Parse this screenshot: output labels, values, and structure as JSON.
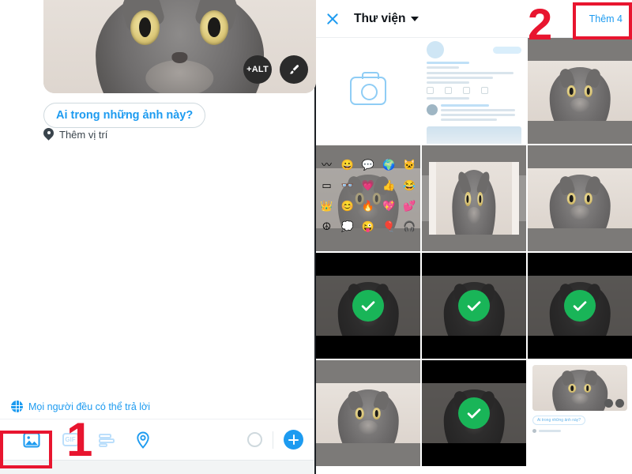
{
  "compose": {
    "photo": {
      "alt_badge": "+ALT",
      "edit_icon": "brush-icon"
    },
    "tag_people_pill": "Ai trong những ảnh này?",
    "add_location": "Thêm vị trí",
    "reply_scope": "Mọi người đều có thể trả lời",
    "toolbar": {
      "image": "image-icon",
      "gif": "GIF",
      "poll": "poll-icon",
      "location": "location-icon",
      "progress": "progress-circle",
      "add": "plus-icon"
    }
  },
  "gallery": {
    "close": "close-icon",
    "title": "Thư viện",
    "dropdown": "chevron-down-icon",
    "add_button": "Thêm 4",
    "cells": [
      {
        "kind": "camera",
        "selected": false
      },
      {
        "kind": "feed-screenshot",
        "selected": false
      },
      {
        "kind": "cat-photo",
        "selected": false
      },
      {
        "kind": "cat-stickers",
        "selected": false
      },
      {
        "kind": "cat-framed",
        "selected": false
      },
      {
        "kind": "cat-photo",
        "selected": false
      },
      {
        "kind": "cat-photo-dark",
        "selected": true
      },
      {
        "kind": "cat-photo-dark",
        "selected": true
      },
      {
        "kind": "cat-photo-dark",
        "selected": true
      },
      {
        "kind": "cat-photo",
        "selected": false
      },
      {
        "kind": "cat-photo-dark",
        "selected": true
      },
      {
        "kind": "compose-screenshot",
        "selected": false
      }
    ]
  },
  "annotations": {
    "step_one": "1",
    "step_two": "2",
    "accent_color": "#e8152f"
  },
  "colors": {
    "twitter_blue": "#1d9bf0",
    "select_green": "#19b558",
    "select_border": "#5ee08a"
  }
}
